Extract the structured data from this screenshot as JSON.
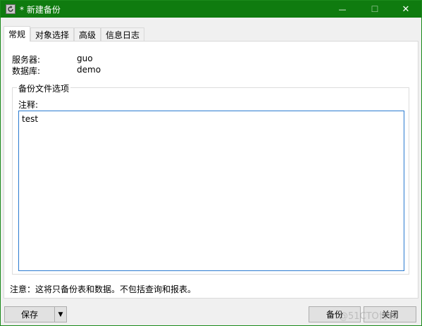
{
  "window": {
    "title": "* 新建备份",
    "minimize_glyph": "—",
    "maximize_glyph": "☐",
    "close_glyph": "✕",
    "icon": "backup-app-icon"
  },
  "tabs": [
    {
      "label": "常规",
      "active": true
    },
    {
      "label": "对象选择",
      "active": false
    },
    {
      "label": "高级",
      "active": false
    },
    {
      "label": "信息日志",
      "active": false
    }
  ],
  "general": {
    "server_label": "服务器:",
    "server_value": "guo",
    "database_label": "数据库:",
    "database_value": "demo",
    "group_title": "备份文件选项",
    "comment_label": "注释:",
    "comment_value": "test",
    "note": "注意：这将只备份表和数据。不包括查询和报表。"
  },
  "buttons": {
    "save": "保存",
    "save_dropdown_glyph": "▼",
    "backup": "备份",
    "close": "关闭"
  },
  "watermark": "@51CTO博客",
  "colors": {
    "titlebar": "#0f7b0f",
    "accent_border": "#2a7bd0"
  }
}
